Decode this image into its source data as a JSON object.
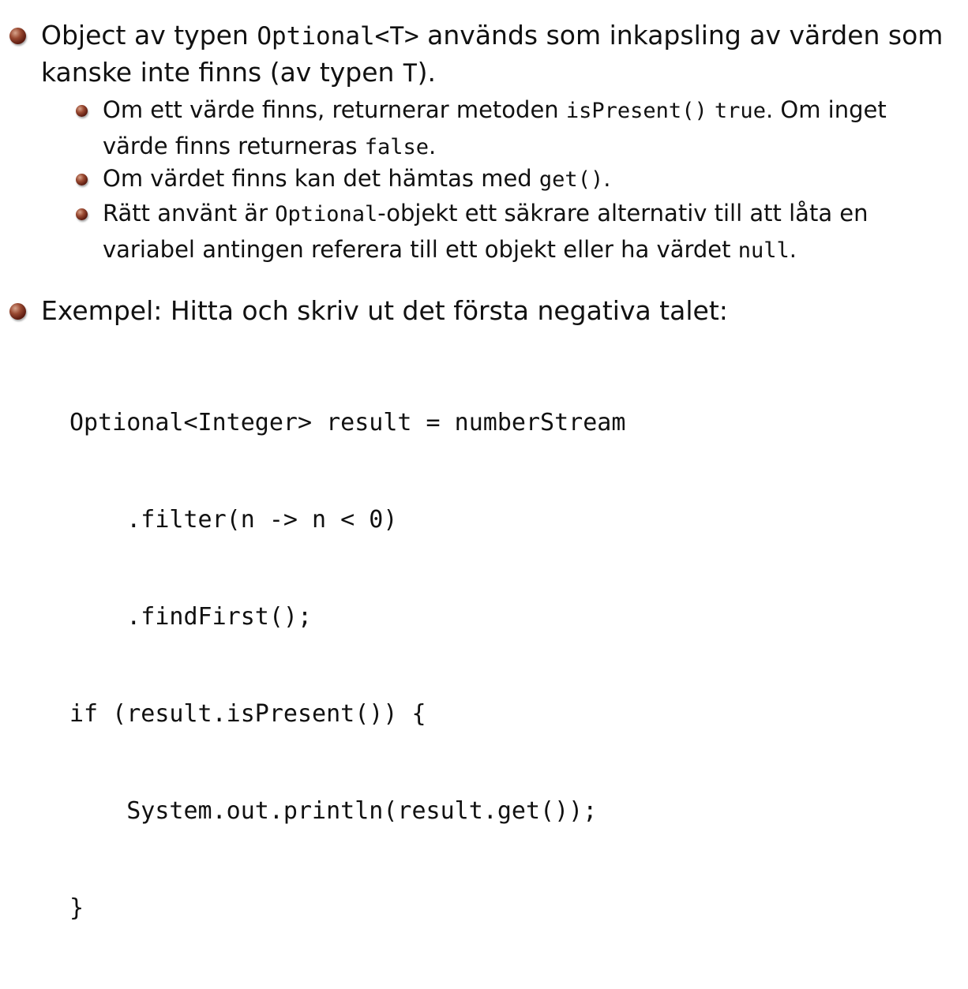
{
  "bullets": {
    "optional_intro": {
      "line1_a": "Object av typen ",
      "line1_code": "Optional<T>",
      "line1_b": " används som inkapsling av värden som",
      "line2_a": "kanske inte finns (av typen ",
      "line2_code": "T",
      "line2_b": ")."
    },
    "is_present": {
      "line1_a": "Om ett värde finns, returnerar metoden ",
      "line1_code1": "isPresent()",
      "line1_sp": " ",
      "line1_code2": "true",
      "line1_b": ". Om inget",
      "line2_a": "värde finns returneras ",
      "line2_code": "false",
      "line2_b": "."
    },
    "get_value": {
      "line1_a": "Om värdet finns kan det hämtas med ",
      "line1_code": "get()",
      "line1_b": "."
    },
    "safer_alternative": {
      "line1_a": "Rätt använt är ",
      "line1_code": "Optional",
      "line1_b": "-objekt ett säkrare alternativ till att låta en",
      "line2_a": "variabel antingen referera till ett objekt eller ha värdet ",
      "line2_code": "null",
      "line2_b": "."
    },
    "example": {
      "line1": "Exempel: Hitta och skriv ut det första negativa talet:"
    }
  },
  "code_example": {
    "lines": [
      "Optional<Integer> result = numberStream",
      "    .filter(n -> n < 0)",
      "    .findFirst();",
      "if (result.isPresent()) {",
      "    System.out.println(result.get());",
      "}"
    ]
  },
  "colors": {
    "bullet": "#6b2414",
    "text": "#111111",
    "background": "#ffffff"
  }
}
